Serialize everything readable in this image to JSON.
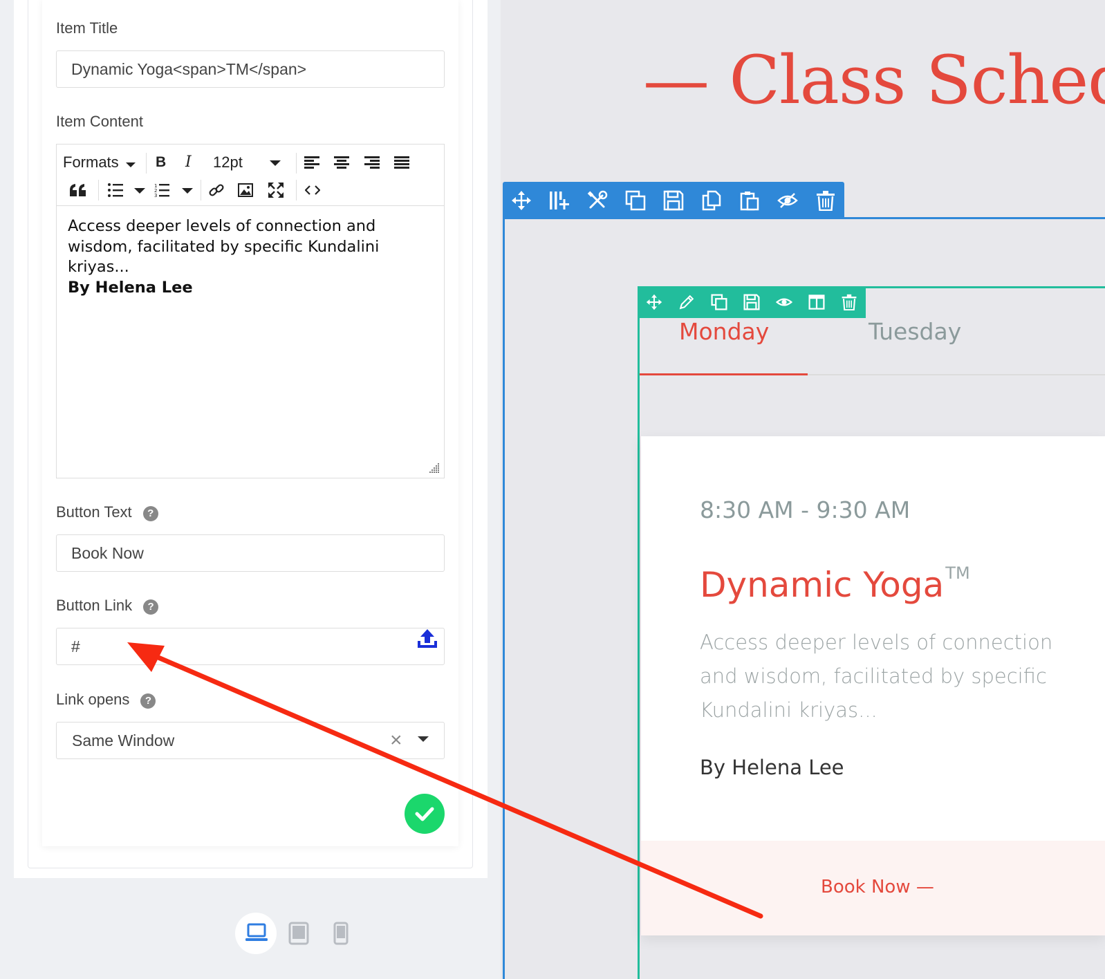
{
  "editor_panel": {
    "item_title": {
      "label": "Item Title",
      "value": "Dynamic Yoga<span>TM</span>"
    },
    "item_content": {
      "label": "Item Content",
      "toolbar": {
        "formats": "Formats",
        "bold": "B",
        "italic": "I",
        "font_size": "12pt"
      },
      "body_text": "Access deeper levels of connection and wisdom, facilitated by specific Kundalini kriyas...",
      "body_bold": "By Helena Lee"
    },
    "button_text": {
      "label": "Button Text",
      "value": "Book Now"
    },
    "button_link": {
      "label": "Button Link",
      "value": "#"
    },
    "link_opens": {
      "label": "Link opens",
      "value": "Same Window",
      "clear_glyph": "×"
    },
    "help_glyph": "?"
  },
  "preview": {
    "heading": "— Class Sched",
    "tabs": [
      {
        "label": "Monday",
        "active": true
      },
      {
        "label": "Tuesday",
        "active": false
      }
    ],
    "card": {
      "time": "8:30 AM - 9:30 AM",
      "title": "Dynamic Yoga",
      "title_sup": "TM",
      "description": "Access deeper levels of connection and wisdom, facilitated by specific Kundalini kriyas...",
      "author": "By Helena Lee",
      "button": "Book Now —"
    }
  },
  "colors": {
    "accent_red": "#e4493d",
    "section_blue": "#2f88d8",
    "module_green": "#22bd9c",
    "save_green": "#1bd76c",
    "annotation_red": "#f62a12"
  },
  "icons": {
    "section_toolbar": [
      "move-icon",
      "add-column-icon",
      "settings-icon",
      "duplicate-icon",
      "save-icon",
      "copy-icon",
      "paste-icon",
      "hide-icon",
      "trash-icon"
    ],
    "module_toolbar": [
      "move-icon",
      "edit-icon",
      "duplicate-icon",
      "save-icon",
      "visibility-icon",
      "columns-icon",
      "trash-icon"
    ],
    "devices": [
      "laptop-icon",
      "tablet-icon",
      "phone-icon"
    ]
  }
}
